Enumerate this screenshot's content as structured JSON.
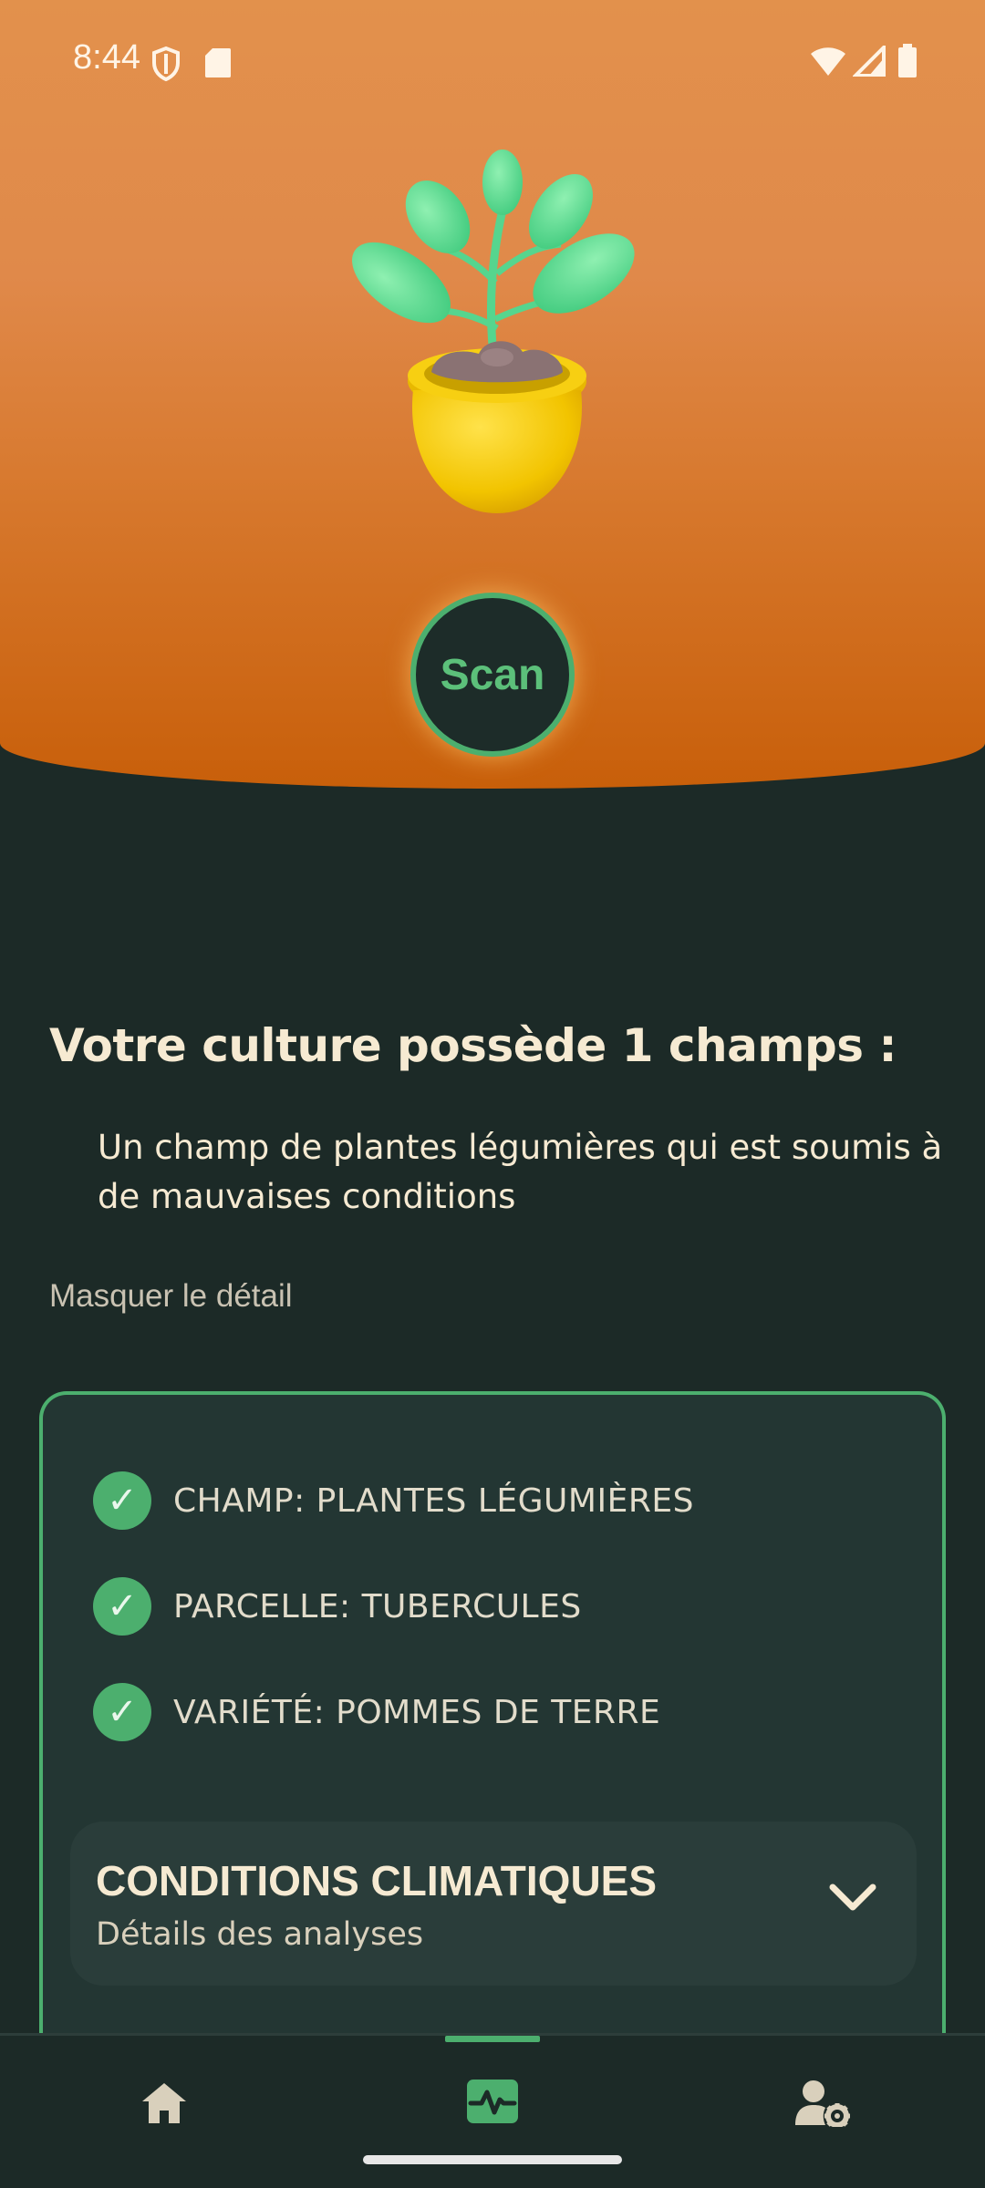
{
  "status_bar": {
    "time": "8:44",
    "icons": [
      "shield-icon",
      "sd-card-icon",
      "wifi-icon",
      "cell-signal-icon",
      "battery-icon"
    ]
  },
  "hero": {
    "illustration": "potted-plant-icon",
    "scan_button_label": "Scan"
  },
  "content": {
    "headline": "Votre culture possède 1 champs :",
    "summary": "Un champ de plantes légumières qui est soumis à de mauvaises conditions",
    "toggle_detail_label": "Masquer le détail"
  },
  "detail_card": {
    "items": [
      {
        "label": "CHAMP: PLANTES LÉGUMIÈRES",
        "icon": "check-icon"
      },
      {
        "label": "PARCELLE: TUBERCULES",
        "icon": "check-icon"
      },
      {
        "label": "VARIÉTÉ: POMMES DE TERRE",
        "icon": "check-icon"
      }
    ],
    "accordion": {
      "title": "CONDITIONS CLIMATIQUES",
      "subtitle": "Détails des analyses",
      "icon": "chevron-down-icon"
    }
  },
  "bottom_nav": {
    "items": [
      {
        "icon": "home-icon",
        "active": false
      },
      {
        "icon": "analysis-pulse-icon",
        "active": true
      },
      {
        "icon": "user-settings-icon",
        "active": false
      }
    ]
  },
  "colors": {
    "accent_green": "#4caf6e",
    "background": "#1c2a27",
    "hero_orange": "#e0894a",
    "text_cream": "#f6ead2"
  }
}
